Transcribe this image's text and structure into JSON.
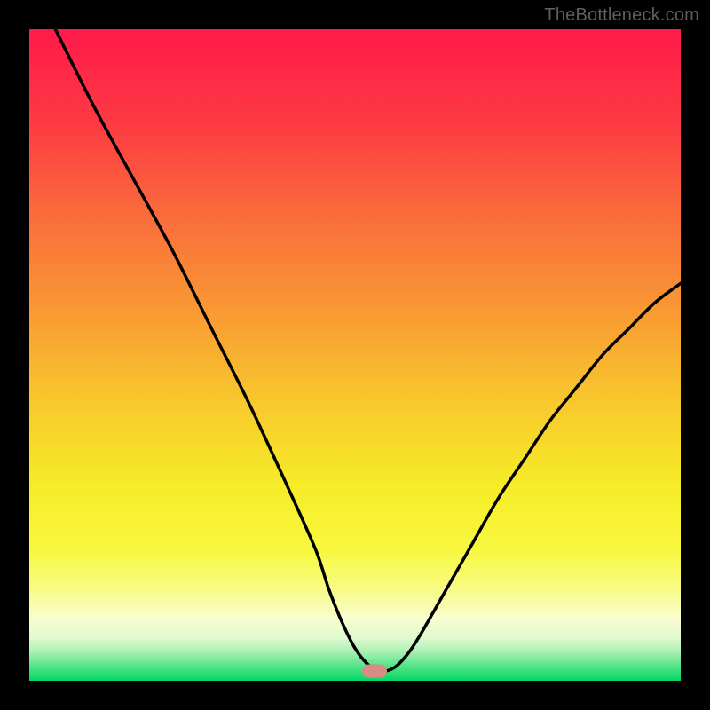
{
  "watermark": "TheBottleneck.com",
  "chart_data": {
    "type": "line",
    "title": "",
    "xlabel": "",
    "ylabel": "",
    "xlim": [
      0,
      100
    ],
    "ylim": [
      0,
      100
    ],
    "grid": false,
    "legend": false,
    "marker": {
      "x": 53,
      "y": 1.5
    },
    "series": [
      {
        "name": "curve",
        "color": "#000000",
        "x": [
          4,
          10,
          16,
          22,
          28,
          34,
          40,
          44,
          46,
          48,
          50,
          52,
          54,
          56,
          58,
          60,
          64,
          68,
          72,
          76,
          80,
          84,
          88,
          92,
          96,
          100
        ],
        "y": [
          100,
          88,
          77,
          66,
          54,
          42,
          29,
          20,
          14,
          9,
          5,
          2.5,
          1.5,
          2,
          4,
          7,
          14,
          21,
          28,
          34,
          40,
          45,
          50,
          54,
          58,
          61
        ]
      }
    ],
    "background_gradient": {
      "stops": [
        {
          "pos": 0.0,
          "color": "#ff1a4a"
        },
        {
          "pos": 0.14,
          "color": "#fd3943"
        },
        {
          "pos": 0.28,
          "color": "#fa6a3c"
        },
        {
          "pos": 0.42,
          "color": "#f99534"
        },
        {
          "pos": 0.56,
          "color": "#f8c42d"
        },
        {
          "pos": 0.7,
          "color": "#f6ec27"
        },
        {
          "pos": 0.8,
          "color": "#f8f83f"
        },
        {
          "pos": 0.86,
          "color": "#f8fb86"
        },
        {
          "pos": 0.905,
          "color": "#f9fdcf"
        },
        {
          "pos": 0.935,
          "color": "#deface"
        },
        {
          "pos": 0.955,
          "color": "#abf1b5"
        },
        {
          "pos": 0.975,
          "color": "#5de58c"
        },
        {
          "pos": 1.0,
          "color": "#00d865"
        }
      ]
    }
  }
}
